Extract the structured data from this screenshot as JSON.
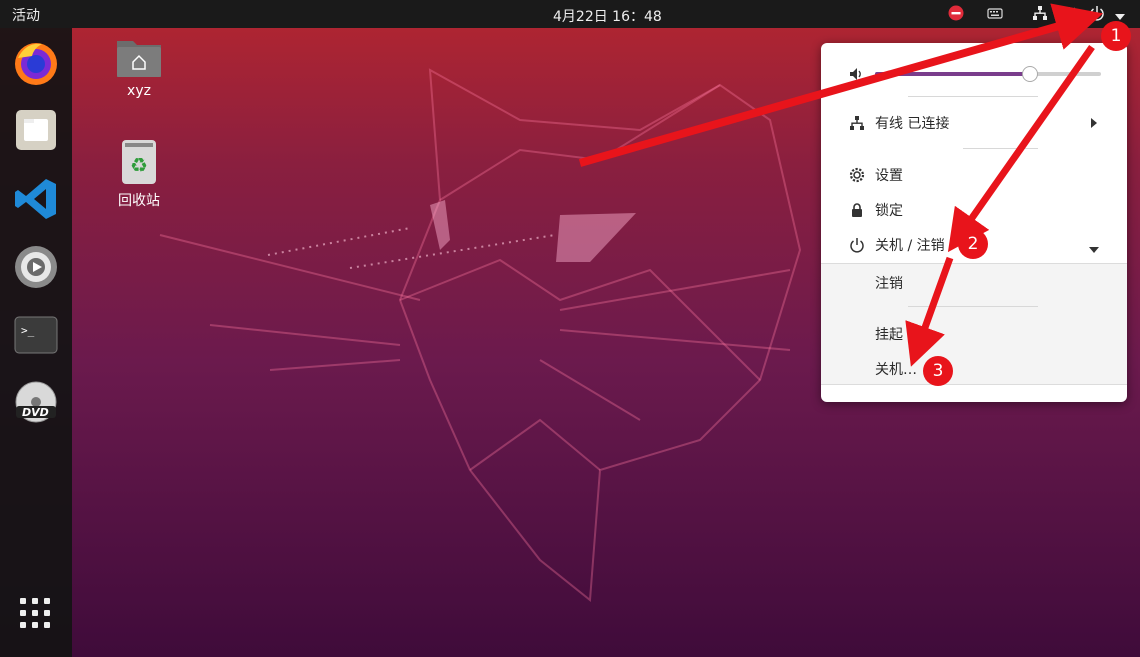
{
  "topbar": {
    "activities": "活动",
    "clock": "4月22日  16：48",
    "tray_icons": [
      "dnd-icon",
      "keyboard-icon",
      "network-icon",
      "volume-icon",
      "power-icon",
      "chevron-down-icon"
    ]
  },
  "dock": {
    "apps": [
      "firefox-icon",
      "files-icon",
      "vscode-icon",
      "software-update-icon",
      "terminal-icon",
      "dvd-icon"
    ],
    "show_apps": "app-grid-icon"
  },
  "desktop": {
    "home_label": "xyz",
    "trash_label": "回收站"
  },
  "system_menu": {
    "volume_level": 0.68,
    "network_label": "有线 已连接",
    "settings_label": "设置",
    "lock_label": "锁定",
    "power_label": "关机 / 注销",
    "logout_label": "注销",
    "suspend_label": "挂起",
    "shutdown_label": "关机…"
  },
  "annotations": {
    "step1": "1",
    "step2": "2",
    "step3": "3",
    "color": "#e8141b"
  }
}
